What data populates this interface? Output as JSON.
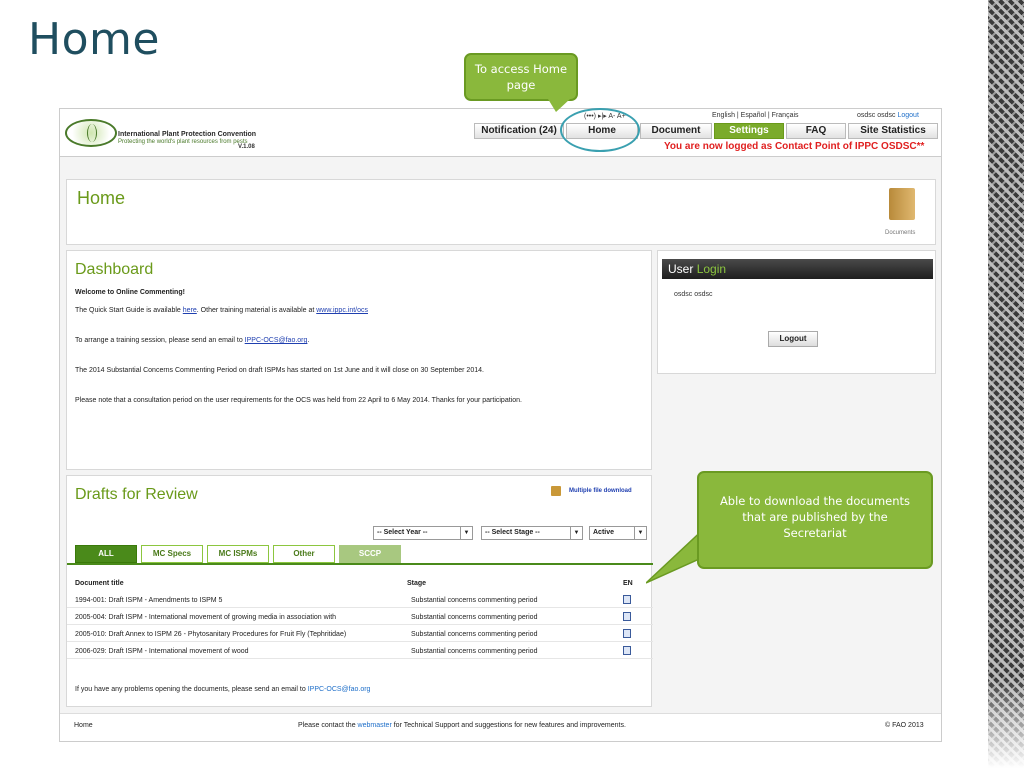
{
  "slide": {
    "title": "Home"
  },
  "callouts": {
    "home": "To access Home page",
    "download": "Able to download the documents that are published by the Secretariat"
  },
  "header": {
    "org_name": "International Plant Protection Convention",
    "tagline": "Protecting the world's plant resources from pests",
    "version": "V.1.08",
    "utility_icons": "(•••)   ▸|▸   A-   A+",
    "languages": "English   |   Español   |   Français",
    "user_name": "osdsc osdsc",
    "logout_link": "Logout",
    "logged_notice": "You are now logged as Contact Point of IPPC OSDSC**"
  },
  "nav": {
    "notification": "Notification (24)",
    "home": "Home",
    "document": "Document",
    "settings": "Settings",
    "faq": "FAQ",
    "site_statistics": "Site Statistics"
  },
  "home_panel": {
    "title": "Home",
    "documents_label": "Documents"
  },
  "dashboard": {
    "title": "Dashboard",
    "welcome": "Welcome to Online Commenting!",
    "line1_a": "The Quick Start Guide is available ",
    "line1_link": "here",
    "line1_b": ". Other training material is available at ",
    "line1_link2": "www.ippc.int/ocs",
    "line2_a": "To arrange a training session, please send an email to ",
    "line2_link": "IPPC-OCS@fao.org",
    "line2_b": ".",
    "line3": "The 2014 Substantial Concerns Commenting Period on draft ISPMs has started on 1st June and it will close on 30 September 2014.",
    "line4": "Please note that a consultation period on the user requirements for the OCS was held from 22 April to 6 May 2014. Thanks for your participation."
  },
  "user_box": {
    "head_user": "User",
    "head_login": "Login",
    "name": "osdsc osdsc",
    "logout_button": "Logout"
  },
  "drafts": {
    "title": "Drafts for Review",
    "multi_download": "Multiple file download",
    "select_year": "-- Select Year --",
    "select_stage": "-- Select Stage --",
    "select_status": "Active",
    "tabs": [
      "ALL",
      "MC Specs",
      "MC ISPMs",
      "Other",
      "SCCP"
    ],
    "columns": {
      "title": "Document title",
      "stage": "Stage",
      "lang": "EN"
    },
    "rows": [
      {
        "title": "1994-001: Draft ISPM - Amendments to ISPM 5",
        "stage": "Substantial concerns commenting period"
      },
      {
        "title": "2005-004: Draft ISPM - International movement of growing media in association with",
        "stage": "Substantial concerns commenting period"
      },
      {
        "title": "2005-010: Draft Annex to ISPM 26 - Phytosanitary Procedures for Fruit Fly (Tephritidae)",
        "stage": "Substantial concerns commenting period"
      },
      {
        "title": "2006-029: Draft ISPM - International movement of wood",
        "stage": "Substantial concerns commenting period"
      }
    ],
    "problems_a": "If you have any problems opening the documents, please send an email to ",
    "problems_link": "IPPC-OCS@fao.org"
  },
  "footer": {
    "home": "Home",
    "contact_a": "Please contact the ",
    "contact_link": "webmaster",
    "contact_b": " for Technical Support and suggestions for new features and improvements.",
    "copyright": "© FAO 2013"
  }
}
